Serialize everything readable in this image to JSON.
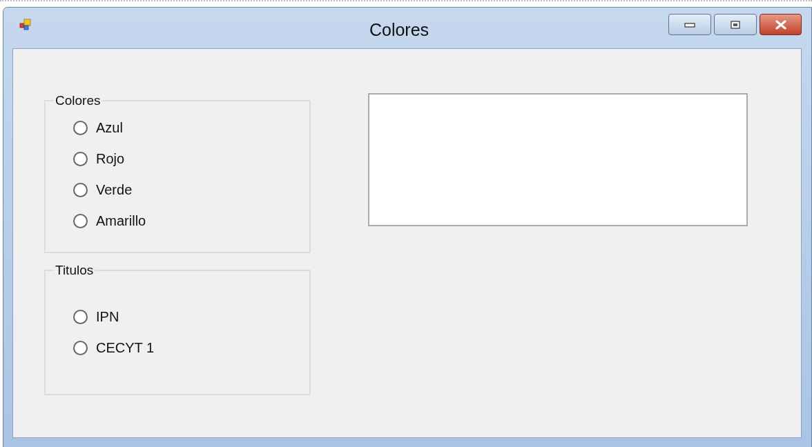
{
  "window": {
    "title": "Colores"
  },
  "groups": [
    {
      "title": "Colores",
      "options": [
        {
          "label": "Azul",
          "selected": false
        },
        {
          "label": "Rojo",
          "selected": false
        },
        {
          "label": "Verde",
          "selected": false
        },
        {
          "label": "Amarillo",
          "selected": false
        }
      ]
    },
    {
      "title": "Titulos",
      "options": [
        {
          "label": "IPN",
          "selected": false
        },
        {
          "label": "CECYT 1",
          "selected": false
        }
      ]
    }
  ]
}
